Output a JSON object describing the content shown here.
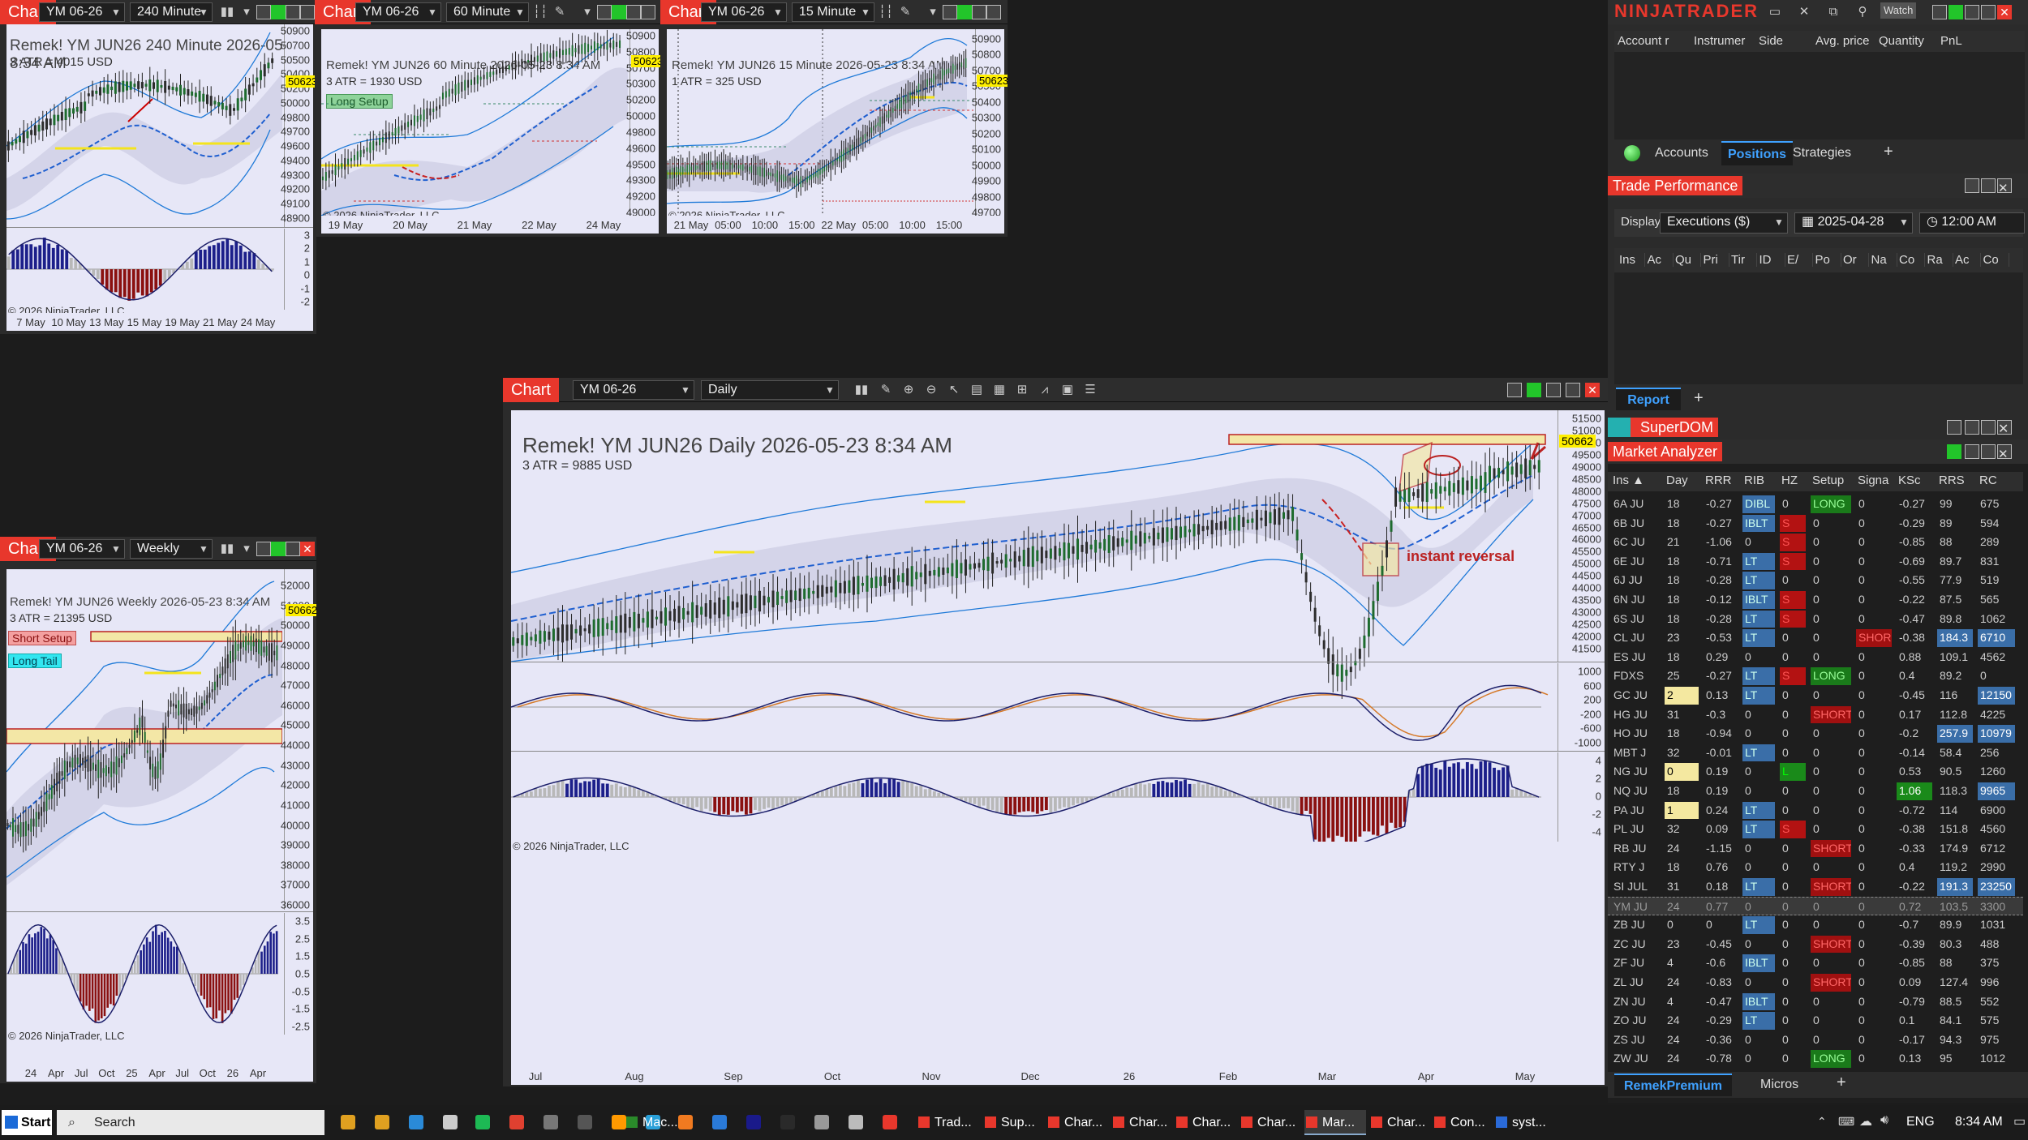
{
  "app": {
    "brand": "NINJATRADER",
    "watch_label": "Watch"
  },
  "toolbar_icons": [
    "bar-chart-icon",
    "draw-pen-icon",
    "zoom-in-icon",
    "zoom-out-icon",
    "pointer-icon",
    "data-box-icon",
    "strategy-icon",
    "indicators-icon",
    "templates-icon",
    "list-icon"
  ],
  "charts": [
    {
      "id": "c240",
      "tab": "Chart",
      "instrument": "YM 06-26",
      "interval": "240 Minute",
      "title": "Remek!  YM JUN26  240 Minute  2026-05-23 8:34 AM",
      "atr": "3 ATR = 4015 USD",
      "last": "50623",
      "copyright": "© 2026 NinjaTrader, LLC",
      "yticks": [
        "50900",
        "50700",
        "50500",
        "50400",
        "50200",
        "50000",
        "49800",
        "49700",
        "49600",
        "49400",
        "49300",
        "49200",
        "49100",
        "48900"
      ],
      "osc_ticks": [
        "3",
        "2",
        "1",
        "0",
        "-1",
        "-2"
      ],
      "xticks": [
        "7 May",
        "10 May",
        "13 May",
        "15 May",
        "19 May",
        "21 May",
        "24 May"
      ]
    },
    {
      "id": "c60",
      "tab": "Chart",
      "instrument": "YM 06-26",
      "interval": "60 Minute",
      "title": "Remek!  YM JUN26  60 Minute  2026-05-23 8:34 AM",
      "atr": "3 ATR = 1930 USD",
      "badge": "Long Setup",
      "last": "50623",
      "copyright": "© 2026 NinjaTrader, LLC",
      "yticks": [
        "50900",
        "50800",
        "50700",
        "50300",
        "50200",
        "50000",
        "49800",
        "49600",
        "49500",
        "49300",
        "49200",
        "49000"
      ],
      "xticks": [
        "19 May",
        "20 May",
        "21 May",
        "22 May",
        "24 May"
      ]
    },
    {
      "id": "c15",
      "tab": "Chart",
      "instrument": "YM 06-26",
      "interval": "15 Minute",
      "title": "Remek!  YM JUN26  15 Minute  2026-05-23 8:34 AM",
      "atr": "1 ATR = 325 USD",
      "last": "50623",
      "copyright": "© 2026 NinjaTrader, LLC",
      "yticks": [
        "50900",
        "50800",
        "50700",
        "50500",
        "50400",
        "50300",
        "50200",
        "50100",
        "50000",
        "49900",
        "49800",
        "49700"
      ],
      "xticks": [
        "21 May",
        "05:00",
        "10:00",
        "15:00",
        "22 May",
        "05:00",
        "10:00",
        "15:00"
      ]
    },
    {
      "id": "cday",
      "tab": "Chart",
      "instrument": "YM 06-26",
      "interval": "Daily",
      "title": "Remek!  YM JUN26  Daily  2026-05-23 8:34 AM",
      "atr": "3 ATR = 9885 USD",
      "last": "50662",
      "annotation": "instant reversal",
      "copyright": "© 2026 NinjaTrader, LLC",
      "yticks": [
        "51500",
        "51000",
        "50000",
        "49500",
        "49000",
        "48500",
        "48000",
        "47500",
        "47000",
        "46500",
        "46000",
        "45500",
        "45000",
        "44500",
        "44000",
        "43500",
        "43000",
        "42500",
        "42000",
        "41500"
      ],
      "osc1_ticks": [
        "1000",
        "600",
        "200",
        "-200",
        "-600",
        "-1000"
      ],
      "osc2_ticks": [
        "4",
        "2",
        "0",
        "-2",
        "-4"
      ],
      "xticks": [
        "Jul",
        "Aug",
        "Sep",
        "Oct",
        "Nov",
        "Dec",
        "26",
        "Feb",
        "Mar",
        "Apr",
        "May"
      ]
    },
    {
      "id": "cweek",
      "tab": "Chart",
      "instrument": "YM 06-26",
      "interval": "Weekly",
      "title": "Remek!  YM JUN26  Weekly  2026-05-23 8:34 AM",
      "atr": "3 ATR = 21395 USD",
      "badge1": "Short Setup",
      "badge2": "Long Tail",
      "last": "50662",
      "copyright": "© 2026 NinjaTrader, LLC",
      "yticks": [
        "52000",
        "51000",
        "50000",
        "49000",
        "48000",
        "47000",
        "46000",
        "45000",
        "44000",
        "43000",
        "42000",
        "41000",
        "40000",
        "39000",
        "38000",
        "37000",
        "36000"
      ],
      "osc_ticks": [
        "3.5",
        "2.5",
        "1.5",
        "0.5",
        "-0.5",
        "-1.5",
        "-2.5"
      ],
      "xticks": [
        "24",
        "Apr",
        "Jul",
        "Oct",
        "25",
        "Apr",
        "Jul",
        "Oct",
        "26",
        "Apr"
      ]
    }
  ],
  "control_center": {
    "columns": [
      "Account r",
      "Instrumer",
      "Side",
      "Avg. price",
      "Quantity",
      "PnL"
    ],
    "tabs": [
      "Accounts",
      "Positions",
      "Strategies"
    ],
    "active_tab": "Positions",
    "add": "+"
  },
  "trade_performance": {
    "title": "Trade Performance",
    "display_label": "Display",
    "display_value": "Executions ($)",
    "date": "2025-04-28",
    "time": "12:00 AM",
    "columns": [
      "Ins",
      "Ac",
      "Qu",
      "Pri",
      "Tir",
      "ID",
      "E/",
      "Po",
      "Or",
      "Na",
      "Co",
      "Ra",
      "Ac",
      "Co"
    ],
    "report_tab": "Report",
    "add": "+"
  },
  "superdom": {
    "title": "SuperDOM"
  },
  "market_analyzer": {
    "title": "Market Analyzer",
    "columns": [
      "Ins ▲",
      "Day",
      "RRR",
      "RIB",
      "HZ",
      "Setup",
      "Signa",
      "KSc",
      "RRS",
      "RC"
    ],
    "rows": [
      [
        "6A JU",
        "18",
        "-0.27",
        "DIBL",
        "0",
        "LONG",
        "0",
        "-0.27",
        "99",
        "675"
      ],
      [
        "6B JU",
        "18",
        "-0.27",
        "IBLT",
        "S",
        "0",
        "0",
        "-0.29",
        "89",
        "594"
      ],
      [
        "6C JU",
        "21",
        "-1.06",
        "0",
        "S",
        "0",
        "0",
        "-0.85",
        "88",
        "289"
      ],
      [
        "6E JU",
        "18",
        "-0.71",
        "LT",
        "S",
        "0",
        "0",
        "-0.69",
        "89.7",
        "831"
      ],
      [
        "6J JU",
        "18",
        "-0.28",
        "LT",
        "0",
        "0",
        "0",
        "-0.55",
        "77.9",
        "519"
      ],
      [
        "6N JU",
        "18",
        "-0.12",
        "IBLT",
        "S",
        "0",
        "0",
        "-0.22",
        "87.5",
        "565"
      ],
      [
        "6S JU",
        "18",
        "-0.28",
        "LT",
        "S",
        "0",
        "0",
        "-0.47",
        "89.8",
        "1062"
      ],
      [
        "CL JU",
        "23",
        "-0.53",
        "LT",
        "0",
        "0",
        "SHOR",
        "-0.38",
        "184.3",
        "6710"
      ],
      [
        "ES JU",
        "18",
        "0.29",
        "0",
        "0",
        "0",
        "0",
        "0.88",
        "109.1",
        "4562"
      ],
      [
        "FDXS",
        "25",
        "-0.27",
        "LT",
        "S",
        "LONG",
        "0",
        "0.4",
        "89.2",
        "0"
      ],
      [
        "GC JU",
        "2",
        "0.13",
        "LT",
        "0",
        "0",
        "0",
        "-0.45",
        "116",
        "12150"
      ],
      [
        "HG JU",
        "31",
        "-0.3",
        "0",
        "0",
        "SHORT",
        "0",
        "0.17",
        "112.8",
        "4225"
      ],
      [
        "HO JU",
        "18",
        "-0.94",
        "0",
        "0",
        "0",
        "0",
        "-0.2",
        "257.9",
        "10979"
      ],
      [
        "MBT J",
        "32",
        "-0.01",
        "LT",
        "0",
        "0",
        "0",
        "-0.14",
        "58.4",
        "256"
      ],
      [
        "NG JU",
        "0",
        "0.19",
        "0",
        "L",
        "0",
        "0",
        "0.53",
        "90.5",
        "1260"
      ],
      [
        "NQ JU",
        "18",
        "0.19",
        "0",
        "0",
        "0",
        "0",
        "1.06",
        "118.3",
        "9965"
      ],
      [
        "PA JU",
        "1",
        "0.24",
        "LT",
        "0",
        "0",
        "0",
        "-0.72",
        "114",
        "6900"
      ],
      [
        "PL JU",
        "32",
        "0.09",
        "LT",
        "S",
        "0",
        "0",
        "-0.38",
        "151.8",
        "4560"
      ],
      [
        "RB JU",
        "24",
        "-1.15",
        "0",
        "0",
        "SHORT",
        "0",
        "-0.33",
        "174.9",
        "6712"
      ],
      [
        "RTY J",
        "18",
        "0.76",
        "0",
        "0",
        "0",
        "0",
        "0.4",
        "119.2",
        "2990"
      ],
      [
        "SI JUL",
        "31",
        "0.18",
        "LT",
        "0",
        "SHORT",
        "0",
        "-0.22",
        "191.3",
        "23250"
      ],
      [
        "YM JU",
        "24",
        "0.77",
        "0",
        "0",
        "0",
        "0",
        "0.72",
        "103.5",
        "3300"
      ],
      [
        "ZB JU",
        "0",
        "0",
        "LT",
        "0",
        "0",
        "0",
        "-0.7",
        "89.9",
        "1031"
      ],
      [
        "ZC JU",
        "23",
        "-0.45",
        "0",
        "0",
        "SHORT",
        "0",
        "-0.39",
        "80.3",
        "488"
      ],
      [
        "ZF JU",
        "4",
        "-0.6",
        "IBLT",
        "0",
        "0",
        "0",
        "-0.85",
        "88",
        "375"
      ],
      [
        "ZL JU",
        "24",
        "-0.83",
        "0",
        "0",
        "SHORT",
        "0",
        "0.09",
        "127.4",
        "996"
      ],
      [
        "ZN JU",
        "4",
        "-0.47",
        "IBLT",
        "0",
        "0",
        "0",
        "-0.79",
        "88.5",
        "552"
      ],
      [
        "ZO JU",
        "24",
        "-0.29",
        "LT",
        "0",
        "0",
        "0",
        "0.1",
        "84.1",
        "575"
      ],
      [
        "ZS JU",
        "24",
        "-0.36",
        "0",
        "0",
        "0",
        "0",
        "-0.17",
        "94.3",
        "975"
      ],
      [
        "ZW JU",
        "24",
        "-0.78",
        "0",
        "0",
        "LONG",
        "0",
        "0.13",
        "95",
        "1012"
      ]
    ],
    "tabs": [
      "RemekPremium",
      "Micros"
    ],
    "add": "+"
  },
  "taskbar": {
    "start": "Start",
    "search": "Search",
    "apps": [
      "Mac...",
      "Trad...",
      "Sup...",
      "Char...",
      "Char...",
      "Char...",
      "Char...",
      "Mar...",
      "Char...",
      "Con...",
      "syst..."
    ],
    "lang": "ENG",
    "time": "8:34 AM"
  },
  "colors": {
    "accent_red": "#e8372c",
    "green": "#22c52a",
    "plot_bg": "#e7e7f7",
    "band_blue": "#2e7bd6",
    "up_candle": "#1e6b2e",
    "down_candle": "#2c2c2c",
    "hist_blue": "#1c1f8a",
    "hist_red": "#8a1010",
    "ma_blue": "#1f5fd0",
    "highlight_yellow": "#ffef00"
  }
}
